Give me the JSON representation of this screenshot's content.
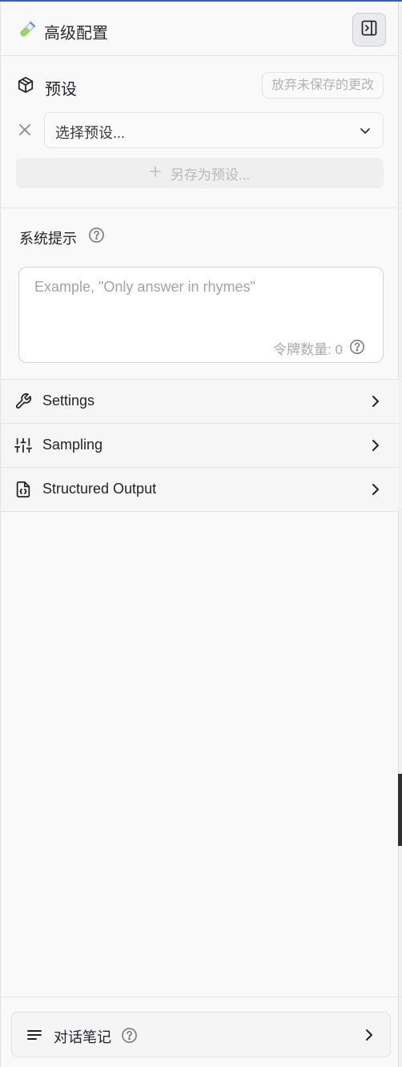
{
  "header": {
    "title": "高级配置",
    "logo_icon": "test-tube-icon",
    "toggle_icon": "sidebar-collapse-icon"
  },
  "presets": {
    "title": "预设",
    "icon": "package-icon",
    "discard_label": "放弃未保存的更改",
    "select_placeholder": "选择预设...",
    "save_as_label": "另存为预设..."
  },
  "system_prompt": {
    "title": "系统提示",
    "placeholder": "Example, \"Only answer in rhymes\"",
    "token_count_label": "令牌数量: 0"
  },
  "sections": [
    {
      "label": "Settings",
      "icon": "wrench-icon"
    },
    {
      "label": "Sampling",
      "icon": "sliders-icon"
    },
    {
      "label": "Structured Output",
      "icon": "code-file-icon"
    }
  ],
  "footer": {
    "notes_label": "对话笔记",
    "notes_icon": "lines-icon"
  },
  "colors": {
    "accent_top": "#3d5bc4",
    "panel_bg": "#f9f9f9",
    "muted_text": "#b3b3b3"
  }
}
